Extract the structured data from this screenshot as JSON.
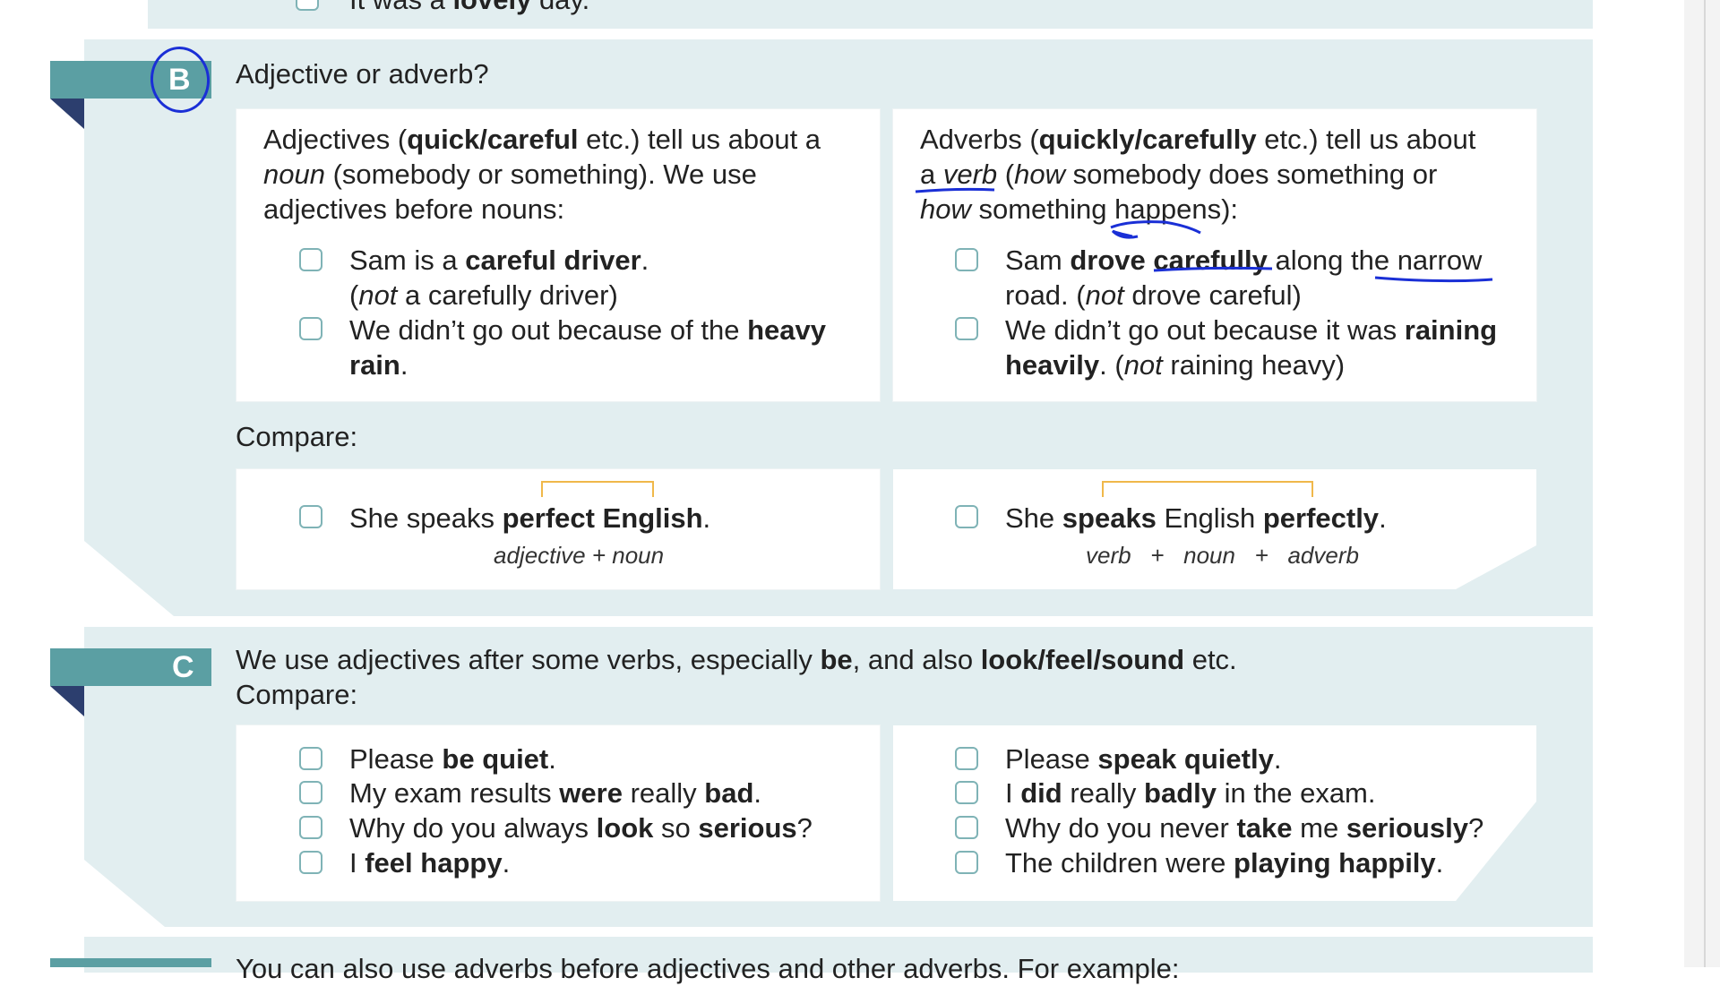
{
  "top": {
    "prefix": "It was a ",
    "bold": "lovely",
    "suffix": " day."
  },
  "sectionB": {
    "letter": "B",
    "heading": "Adjective or adverb?",
    "left": {
      "l1a": "Adjectives (",
      "l1b": "quick",
      "l1c": "/",
      "l1d": "careful",
      "l1e": " etc.) tell us about a",
      "l2a": "noun",
      "l2b": " (somebody or something).  We use",
      "l3": "adjectives before nouns:",
      "ex1a": "Sam is a ",
      "ex1b": "careful driver",
      "ex1c": ".",
      "ex1n_a": "(",
      "ex1n_b": "not",
      "ex1n_c": " a carefully driver)",
      "ex2a": "We didn’t go out because of the ",
      "ex2b": "heavy",
      "ex2c": "rain",
      "ex2d": "."
    },
    "right": {
      "l1a": "Adverbs (",
      "l1b": "quickly",
      "l1c": "/",
      "l1d": "carefully",
      "l1e": " etc.) tell us about",
      "l2a": "a ",
      "l2b": "verb",
      "l2c": " (",
      "l2d": "how",
      "l2e": " somebody does something or",
      "l3a": "how",
      "l3b": " something happens):",
      "ex1a": "Sam ",
      "ex1b": "drove carefully",
      "ex1c": " along the narrow",
      "ex1n_a": "road.  (",
      "ex1n_b": "not",
      "ex1n_c": " drove careful)",
      "ex2a": "We didn’t go out because it was ",
      "ex2b": "raining",
      "ex2c": "heavily",
      "ex2d": ".  (",
      "ex2e": "not",
      "ex2f": " raining heavy)"
    },
    "compare": "Compare:",
    "cmpLeft": {
      "a": "She speaks ",
      "b": "perfect English",
      "c": ".",
      "note": "adjective  +  noun"
    },
    "cmpRight": {
      "a": "She ",
      "b": "speaks",
      "c": " English ",
      "d": "perfectly",
      "e": ".",
      "note": "verb   +   noun   +   adverb"
    }
  },
  "sectionC": {
    "letter": "C",
    "l1a": "We use adjectives after some verbs, especially ",
    "l1b": "be",
    "l1c": ", and also ",
    "l1d": "look",
    "l1e": "/",
    "l1f": "feel",
    "l1g": "/",
    "l1h": "sound",
    "l1i": " etc.",
    "l2": "Compare:",
    "left": [
      {
        "a": "Please ",
        "b": "be quiet",
        "c": "."
      },
      {
        "a": "My exam results ",
        "b": "were",
        "c": " really ",
        "d": "bad",
        "e": "."
      },
      {
        "a": "Why do you always ",
        "b": "look",
        "c": " so ",
        "d": "serious",
        "e": "?"
      },
      {
        "a": "I ",
        "b": "feel happy",
        "c": "."
      }
    ],
    "right": [
      {
        "a": "Please ",
        "b": "speak quietly",
        "c": "."
      },
      {
        "a": "I ",
        "b": "did",
        "c": " really ",
        "d": "badly",
        "e": " in the exam."
      },
      {
        "a": "Why do you never ",
        "b": "take",
        "c": " me ",
        "d": "seriously",
        "e": "?"
      },
      {
        "a": "The children were ",
        "b": "playing happily",
        "c": "."
      }
    ]
  },
  "sectionD": {
    "text": "You can also use adverbs before adjectives and other adverbs.  For example:"
  },
  "colors": {
    "panel": "#e2eef0",
    "tab": "#5b9fa3",
    "tabFold": "#2c3e6e",
    "checkbox": "#7fb3b6",
    "bracket": "#f0b84a",
    "ink": "#1a2fd6"
  }
}
